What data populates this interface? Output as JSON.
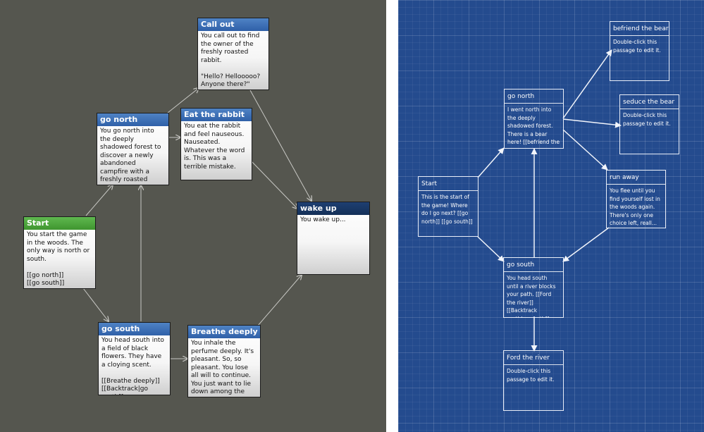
{
  "left_view": {
    "passages": [
      {
        "id": "call_out",
        "title": "Call out",
        "excerpt": "You call out to find the owner of the freshly roasted rabbit.\n\n\"Hello? Hellooooo? Anyone there?\""
      },
      {
        "id": "go_north",
        "title": "go north",
        "excerpt": "You go north into the deeply shadowed forest to discover a newly abandoned campfire with a freshly roasted rabbit. There is no sign of anyone"
      },
      {
        "id": "eat_rabbit",
        "title": "Eat the rabbit",
        "excerpt": "You eat the rabbit and feel nauseous. Nauseated. Whatever the word is. This was a terrible mistake.\n\n[[You black out.|wake"
      },
      {
        "id": "wake_up",
        "title": "wake up",
        "excerpt": "You wake up..."
      },
      {
        "id": "start",
        "title": "Start",
        "excerpt": "You start the game in the woods. The only way is north or south.\n\n[[go north]]\n[[go south]]"
      },
      {
        "id": "go_south",
        "title": "go south",
        "excerpt": "You head south into a field of black flowers. They have a cloying scent.\n\n[[Breathe deeply]]\n[[Backtrack|go north]]"
      },
      {
        "id": "breathe",
        "title": "Breathe deeply",
        "excerpt": "You inhale the perfume deeply. It's pleasant. So, so pleasant. You lose all will to continue. You just want to lie down among the flowers and"
      }
    ]
  },
  "right_view": {
    "passages": [
      {
        "id": "befriend",
        "title": "befriend the bear",
        "excerpt": "Double-click this passage to edit it."
      },
      {
        "id": "seduce",
        "title": "seduce the bear",
        "excerpt": "Double-click this passage to edit it."
      },
      {
        "id": "go_north",
        "title": "go north",
        "excerpt": "I went north into the deeply shadowed forest. There is a bear here! [[befriend the bear]] [[seduce..."
      },
      {
        "id": "run_away",
        "title": "run away",
        "excerpt": "You flee until you find yourself lost in the woods again. There's only one choice left, reall..."
      },
      {
        "id": "start",
        "title": "Start",
        "excerpt": "This is the start of the game! Where do I go next? [[go north]] [[go south]]"
      },
      {
        "id": "go_south",
        "title": "go south",
        "excerpt": "You head south until a river blocks your path. [[Ford the river]] [[Backtrack north|go north]]"
      },
      {
        "id": "ford",
        "title": "Ford the river",
        "excerpt": "Double-click this passage to edit it."
      }
    ]
  }
}
